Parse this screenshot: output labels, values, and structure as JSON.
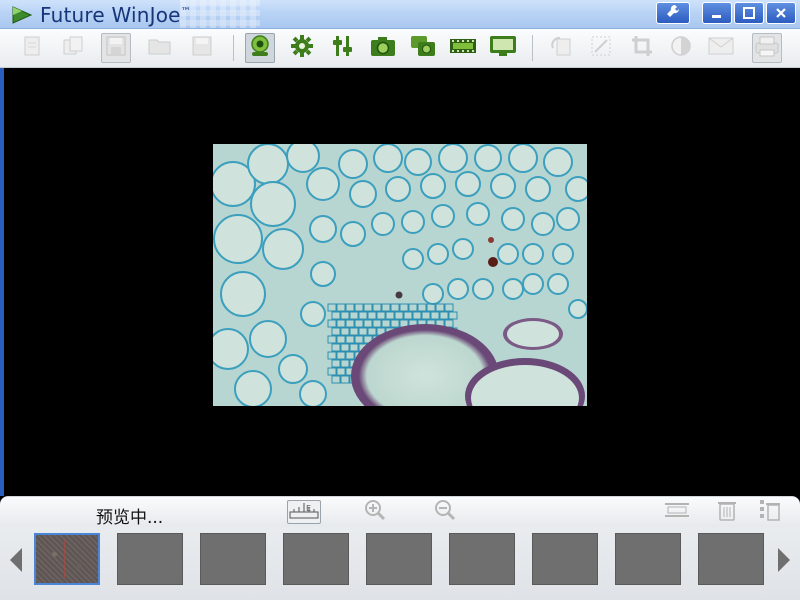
{
  "app": {
    "title": "Future WinJoe",
    "trademark": "™"
  },
  "window_controls": {
    "tools_icon": "wrench-icon",
    "minimize_icon": "minimize-icon",
    "maximize_icon": "maximize-icon",
    "close_icon": "close-icon"
  },
  "toolbar": {
    "buttons": [
      "new-icon",
      "copy-icon",
      "save-as-icon",
      "open-folder-icon",
      "save-icon",
      "camera-preview-icon",
      "settings-gear-icon",
      "adjust-sliders-icon",
      "snapshot-camera-icon",
      "multi-capture-icon",
      "video-film-icon",
      "screen-monitor-icon",
      "rotate-icon",
      "resize-icon",
      "crop-icon",
      "contrast-icon",
      "email-icon",
      "print-icon"
    ]
  },
  "status": {
    "text": "预览中..."
  },
  "statusbar_buttons": {
    "ruler_icon": "ruler-icon",
    "zoom_in_icon": "zoom-in-icon",
    "zoom_out_icon": "zoom-out-icon",
    "fit_width_icon": "fit-width-icon",
    "delete_icon": "trash-icon",
    "delete_all_icon": "delete-all-icon"
  },
  "filmstrip": {
    "thumbnail_count": 9,
    "selected_index": 0,
    "prev_icon": "chevron-left-icon",
    "next_icon": "chevron-right-icon"
  },
  "colors": {
    "titlebar": "#b9d3f5",
    "title_text": "#17367a",
    "accent_blue": "#2c5cc0",
    "icon_green": "#3e7d1c",
    "specimen_stain": "#4aa7bf"
  }
}
